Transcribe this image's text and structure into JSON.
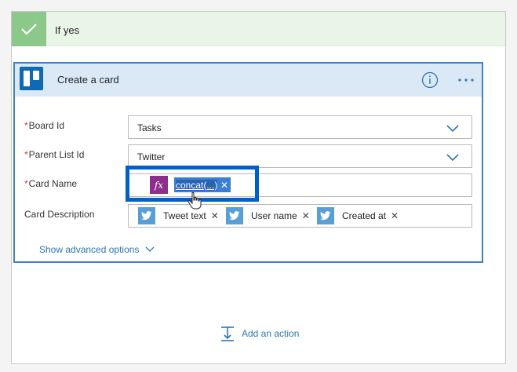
{
  "condition": {
    "label": "If yes"
  },
  "card": {
    "title": "Create a card",
    "icons": {
      "logo": "trello-icon",
      "info": "info-icon",
      "more": "more-options-icon"
    },
    "fields": {
      "board_id": {
        "label": "Board Id",
        "required": true,
        "value": "Tasks"
      },
      "parent_list_id": {
        "label": "Parent List Id",
        "required": true,
        "value": "Twitter"
      },
      "card_name": {
        "label": "Card Name",
        "required": true,
        "expression": "concat(...)",
        "expression_icon": "fx"
      },
      "card_description": {
        "label": "Card Description",
        "required": false,
        "tokens": [
          "Tweet text",
          "User name",
          "Created at"
        ]
      }
    },
    "show_advanced_label": "Show advanced options"
  },
  "add_action_label": "Add an action",
  "colors": {
    "success_green": "#8bc88a",
    "card_border": "#3c82c4",
    "header_blue": "#dbe9f7",
    "trello_blue": "#0e6ab3",
    "twitter_blue": "#5a9ed6",
    "expression_purple": "#8e2d8e",
    "highlight_blue": "#0060c8",
    "link_blue": "#2c74b5",
    "required_red": "#d9302c"
  }
}
